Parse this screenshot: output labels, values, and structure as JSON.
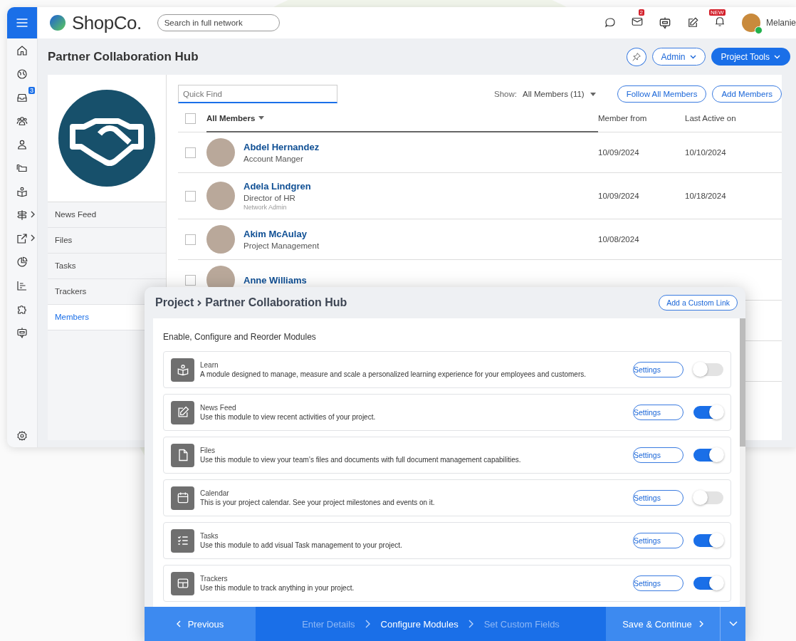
{
  "topbar": {
    "brand": "ShopCo.",
    "search": {
      "placeholder": "Search in full network"
    },
    "mail_badge": "2",
    "bell_badge": "NEW",
    "user": {
      "name": "Melanie",
      "online": true
    }
  },
  "rail": {
    "inbox_badge": "3"
  },
  "page": {
    "title": "Partner Collaboration Hub",
    "admin_button": "Admin",
    "tools_button": "Project Tools"
  },
  "project_nav": [
    {
      "label": "News Feed",
      "selected": false
    },
    {
      "label": "Files",
      "selected": false
    },
    {
      "label": "Tasks",
      "selected": false
    },
    {
      "label": "Trackers",
      "selected": false
    },
    {
      "label": "Members",
      "selected": true
    }
  ],
  "members": {
    "quick_find": {
      "placeholder": "Quick Find"
    },
    "show_label": "Show:",
    "show_value": "All Members (11)",
    "follow_button": "Follow All Members",
    "add_button": "Add Members",
    "select_all_checked": false,
    "columns": [
      "All Members",
      "Member from",
      "Last Active on"
    ],
    "rows": [
      {
        "name": "Abdel Hernandez",
        "role": "Account Manger",
        "member_from": "10/09/2024",
        "last_active": "10/10/2024",
        "checked": false
      },
      {
        "name": "Adela Lindgren",
        "role": "Director of HR",
        "note": "Network Admin",
        "member_from": "10/09/2024",
        "last_active": "10/18/2024",
        "checked": false
      },
      {
        "name": "Akim McAulay",
        "role": "Project Management",
        "member_from": "10/08/2024",
        "checked": false
      },
      {
        "name": "Anne Williams",
        "checked": false
      }
    ]
  },
  "modal": {
    "crumb": "Project",
    "title": "Partner Collaboration Hub",
    "custom_link_button": "Add a Custom Link",
    "heading": "Enable, Configure and Reorder Modules",
    "modules": [
      {
        "name": "Learn",
        "description": "A module designed to manage, measure and scale a personalized learning experience for your employees and customers.",
        "settings": "Settings",
        "on": false
      },
      {
        "name": "News Feed",
        "description": "Use this module to view recent activities of your project.",
        "settings": "Settings",
        "on": true
      },
      {
        "name": "Files",
        "description": "Use this module to  view your team’s files and documents with full document management capabilities.",
        "settings": "Settings",
        "on": true
      },
      {
        "name": "Calendar",
        "description": "This is your project calendar. See your project milestones and events on it.",
        "settings": "Settings",
        "on": false
      },
      {
        "name": "Tasks",
        "description": "Use this module to add visual Task management to your project.",
        "settings": "Settings",
        "on": true
      },
      {
        "name": "Trackers",
        "description": "Use this module to track anything in your project.",
        "settings": "Settings",
        "on": true
      }
    ],
    "previous_button": "Previous",
    "steps": [
      {
        "label": "Enter Details",
        "selected": false
      },
      {
        "label": "Configure Modules",
        "selected": true
      },
      {
        "label": "Set Custom Fields",
        "selected": false
      }
    ],
    "save_button": "Save & Continue"
  }
}
